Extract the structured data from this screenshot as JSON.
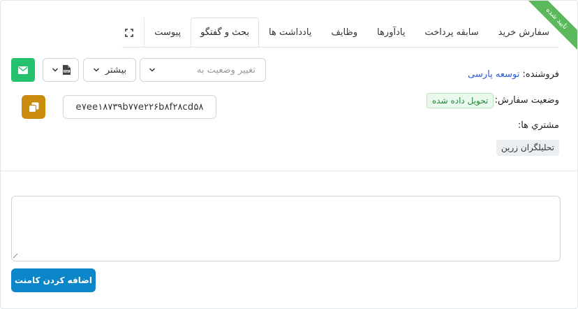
{
  "ribbon": {
    "text": "تایید شده",
    "color": "#5cb85c"
  },
  "tabs": [
    {
      "label": "سفارش خرید"
    },
    {
      "label": "سابقه پرداخت"
    },
    {
      "label": "یادآورها"
    },
    {
      "label": "وظایف"
    },
    {
      "label": "یادداشت ها"
    },
    {
      "label": "بحث و گفتگو",
      "active": true
    },
    {
      "label": "پیوست"
    }
  ],
  "toolbar": {
    "status_placeholder": "تغییر وضعیت به",
    "more_label": "بیشتر",
    "pdf_icon": "pdf-icon",
    "mail_icon": "envelope-icon",
    "mail_color": "#25c16f"
  },
  "order": {
    "seller_label": "فروشنده:",
    "seller_value": "توسعه پارسی",
    "status_label": "وضعیت سفارش:",
    "status_value": "تحویل داده شده",
    "customers_label": "مشتري ها:",
    "customer_value": "تحلیلگران زرین",
    "id_value": "e۷ee۱۸۷۳۹b۷۷e۲۲۶b۸f۲۸cd۵۸",
    "copy_icon": "copy-icon",
    "copy_color": "#c98a0e"
  },
  "comment": {
    "value": "",
    "submit_label": "اضافه کردن کامنت",
    "submit_color": "#0d85c9"
  }
}
